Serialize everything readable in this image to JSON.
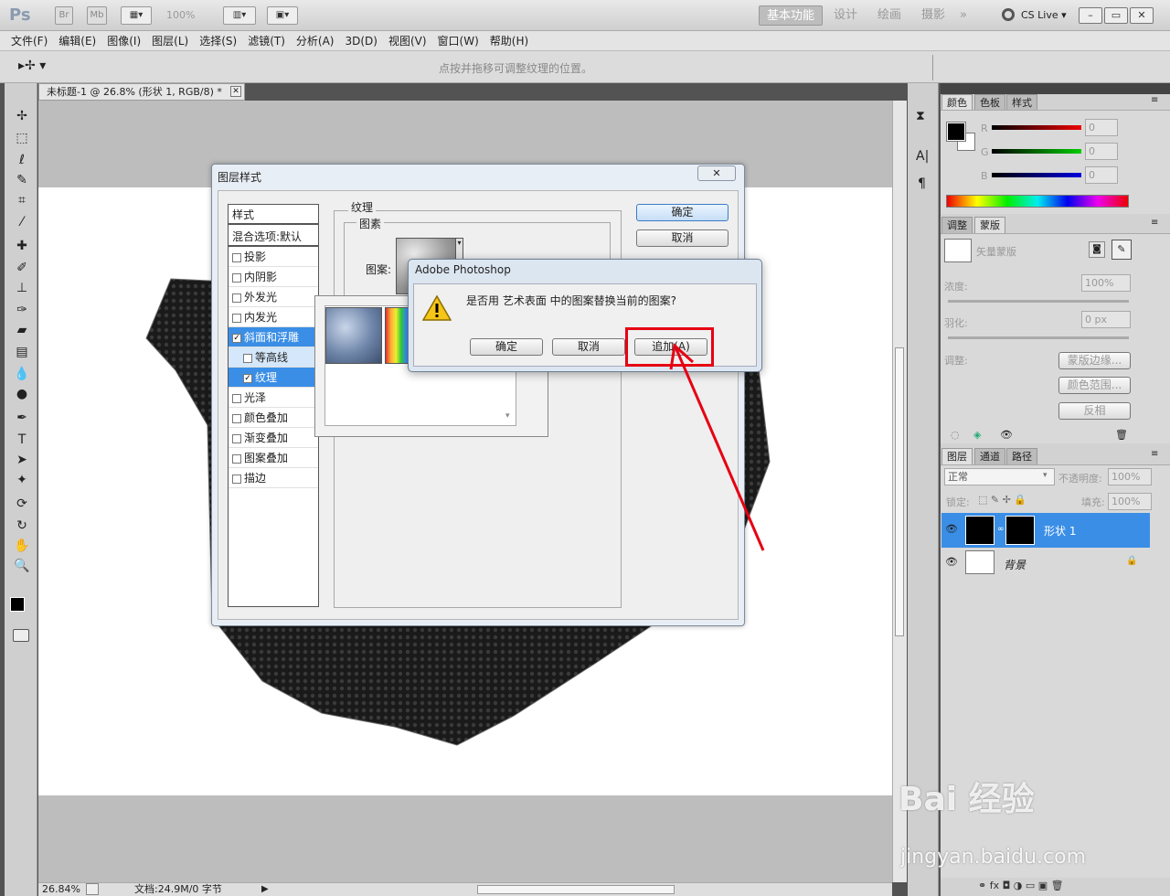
{
  "app": {
    "logo": "Ps",
    "launch_bridge": "Br",
    "launch_minibridge": "Mb",
    "zoom_combo": "100%",
    "workspaces": [
      "基本功能",
      "设计",
      "绘画",
      "摄影"
    ],
    "more": "»",
    "cs_live": "CS Live"
  },
  "menu": [
    "文件(F)",
    "编辑(E)",
    "图像(I)",
    "图层(L)",
    "选择(S)",
    "滤镜(T)",
    "分析(A)",
    "3D(D)",
    "视图(V)",
    "窗口(W)",
    "帮助(H)"
  ],
  "options_hint": "点按并拖移可调整纹理的位置。",
  "document": {
    "tab_title": "未标题-1 @ 26.8% (形状 1, RGB/8) *",
    "status_zoom": "26.84%",
    "status_info": "文档:24.9M/0 字节"
  },
  "layer_style_dialog": {
    "title": "图层样式",
    "styles_header": "样式",
    "blend_options": "混合选项:默认",
    "items": [
      {
        "label": "投影",
        "checked": false
      },
      {
        "label": "内阴影",
        "checked": false
      },
      {
        "label": "外发光",
        "checked": false
      },
      {
        "label": "内发光",
        "checked": false
      },
      {
        "label": "斜面和浮雕",
        "checked": true
      },
      {
        "label": "等高线",
        "checked": false
      },
      {
        "label": "纹理",
        "checked": true
      },
      {
        "label": "光泽",
        "checked": false
      },
      {
        "label": "颜色叠加",
        "checked": false
      },
      {
        "label": "渐变叠加",
        "checked": false
      },
      {
        "label": "图案叠加",
        "checked": false
      },
      {
        "label": "描边",
        "checked": false
      }
    ],
    "group_texture": "纹理",
    "group_pattern": "图素",
    "pattern_label": "图案:",
    "ok": "确定",
    "cancel": "取消"
  },
  "alert": {
    "title": "Adobe Photoshop",
    "message": "是否用 艺术表面 中的图案替换当前的图案?",
    "ok": "确定",
    "cancel": "取消",
    "append": "追加(A)"
  },
  "color_panel": {
    "tabs": [
      "颜色",
      "色板",
      "样式"
    ],
    "r_label": "R",
    "g_label": "G",
    "b_label": "B",
    "r": "0",
    "g": "0",
    "b": "0"
  },
  "masks_panel": {
    "tabs": [
      "调整",
      "蒙版"
    ],
    "vector_mask": "矢量蒙版",
    "density_label": "浓度:",
    "density": "100%",
    "feather_label": "羽化:",
    "feather": "0 px",
    "refine_label": "调整:",
    "mask_edge": "蒙版边缘...",
    "color_range": "颜色范围...",
    "invert": "反相"
  },
  "layers_panel": {
    "tabs": [
      "图层",
      "通道",
      "路径"
    ],
    "blend_mode": "正常",
    "opacity_label": "不透明度:",
    "opacity": "100%",
    "lock_label": "锁定:",
    "fill_label": "填充:",
    "fill": "100%",
    "layers": [
      {
        "name": "形状 1",
        "selected": true
      },
      {
        "name": "背景",
        "selected": false
      }
    ]
  },
  "watermark": {
    "brand": "Bai 经验",
    "url": "jingyan.baidu.com"
  },
  "colors": {
    "accent": "#3a8ee6",
    "highlight": "#e60012",
    "shape": "#1e1e1e"
  }
}
